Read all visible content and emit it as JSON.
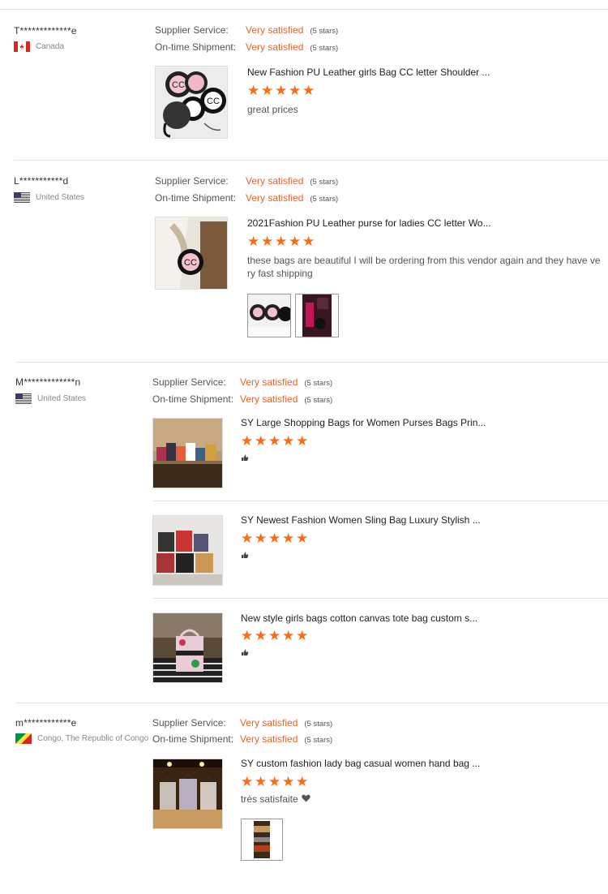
{
  "reviews": [
    {
      "user": "T*************e",
      "country": "Canada",
      "supplier_label": "Supplier Service:",
      "supplier_value": "Very satisfied",
      "supplier_stars": "(5 stars)",
      "shipment_label": "On-time Shipment:",
      "shipment_value": "Very satisfied",
      "shipment_stars": "(5 stars)",
      "products": [
        {
          "name": "New Fashion PU Leather girls Bag CC letter Shoulder ...",
          "comment": "great prices"
        }
      ]
    },
    {
      "user": "L***********d",
      "country": "United States",
      "supplier_label": "Supplier Service:",
      "supplier_value": "Very satisfied",
      "supplier_stars": "(5 stars)",
      "shipment_label": "On-time Shipment:",
      "shipment_value": "Very satisfied",
      "shipment_stars": "(5 stars)",
      "products": [
        {
          "name": "2021Fashion PU Leather purse for ladies CC letter Wo...",
          "comment_line1": "these bags are beautiful I will be ordering from this vendor again and they have ve",
          "comment_line2": "ry fast shipping"
        }
      ]
    },
    {
      "user": "M*************n",
      "country": "United States",
      "supplier_label": "Supplier Service:",
      "supplier_value": "Very satisfied",
      "supplier_stars": "(5 stars)",
      "shipment_label": "On-time Shipment:",
      "shipment_value": "Very satisfied",
      "shipment_stars": "(5 stars)",
      "products": [
        {
          "name": "SY Large Shopping Bags for Women Purses Bags Prin..."
        },
        {
          "name": "SY Newest Fashion Women Sling Bag Luxury Stylish ..."
        },
        {
          "name": "New style girls bags cotton canvas tote bag custom s..."
        }
      ]
    },
    {
      "user": "m************e",
      "country": "Congo, The Republic of Congo",
      "supplier_label": "Supplier Service:",
      "supplier_value": "Very satisfied",
      "supplier_stars": "(5 stars)",
      "shipment_label": "On-time Shipment:",
      "shipment_value": "Very satisfied",
      "shipment_stars": "(5 stars)",
      "products": [
        {
          "name": "SY custom fashion lady bag casual women hand bag ...",
          "comment": "très satisfaite"
        }
      ]
    }
  ],
  "star_glyph": "★",
  "colors": {
    "accent": "#f06020",
    "star": "#ff6a12"
  }
}
